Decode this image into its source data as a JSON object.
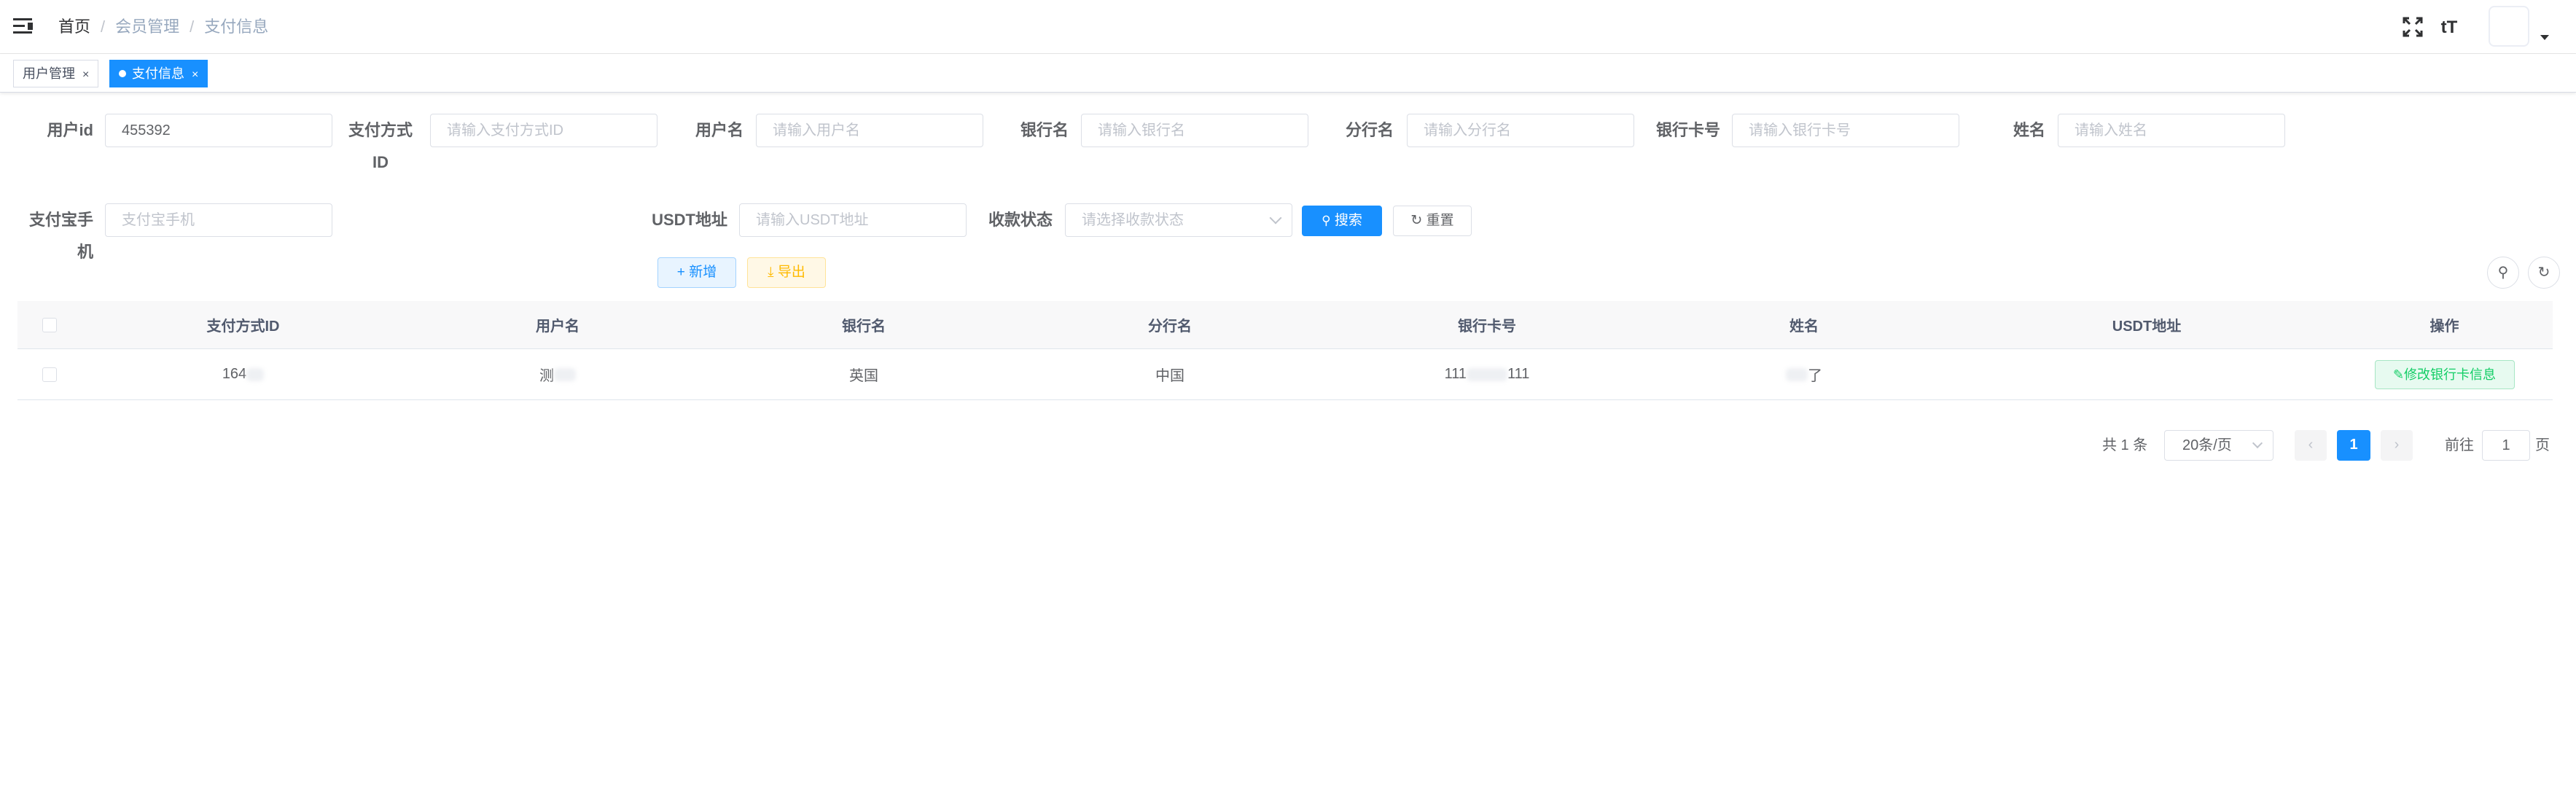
{
  "breadcrumb": {
    "home": "首页",
    "sep": "/",
    "level1": "会员管理",
    "level2": "支付信息"
  },
  "header_icons": {
    "fullscreen": "⛶",
    "font_size": "tT"
  },
  "tabs": [
    {
      "label": "用户管理",
      "close": "×"
    },
    {
      "label": "支付信息",
      "close": "×"
    }
  ],
  "form": {
    "user_id": {
      "label": "用户id",
      "value": "455392"
    },
    "pay_method_id": {
      "label_line1": "支付方式",
      "label_line2": "ID",
      "placeholder": "请输入支付方式ID"
    },
    "username": {
      "label": "用户名",
      "placeholder": "请输入用户名"
    },
    "bank_name": {
      "label": "银行名",
      "placeholder": "请输入银行名"
    },
    "branch_name": {
      "label": "分行名",
      "placeholder": "请输入分行名"
    },
    "bank_card": {
      "label": "银行卡号",
      "placeholder": "请输入银行卡号"
    },
    "real_name": {
      "label": "姓名",
      "placeholder": "请输入姓名"
    },
    "alipay": {
      "label_line1": "支付宝手",
      "label_line2": "机",
      "placeholder": "支付宝手机"
    },
    "usdt": {
      "label": "USDT地址",
      "placeholder": "请输入USDT地址"
    },
    "collect_status": {
      "label": "收款状态",
      "placeholder": "请选择收款状态"
    },
    "search_button": "搜索",
    "reset_button": "重置"
  },
  "toolbar": {
    "add_button": "新增",
    "export_button": "导出"
  },
  "table": {
    "headers": [
      "支付方式ID",
      "用户名",
      "银行名",
      "分行名",
      "银行卡号",
      "姓名",
      "USDT地址",
      "操作"
    ],
    "rows": [
      {
        "pay_method_id": "164",
        "username_prefix": "测",
        "bank_name": "英国",
        "branch_name": "中国",
        "bank_card_prefix": "111",
        "bank_card_suffix": "111",
        "real_name_suffix": "了",
        "usdt": "",
        "action": "修改银行卡信息"
      }
    ]
  },
  "pagination": {
    "total": "共 1 条",
    "page_size": "20条/页",
    "current_page": "1",
    "goto_prefix": "前往",
    "goto_value": "1",
    "goto_suffix": "页"
  },
  "colors": {
    "primary": "#1890ff",
    "success": "#13ce66",
    "warning": "#ffba00"
  }
}
